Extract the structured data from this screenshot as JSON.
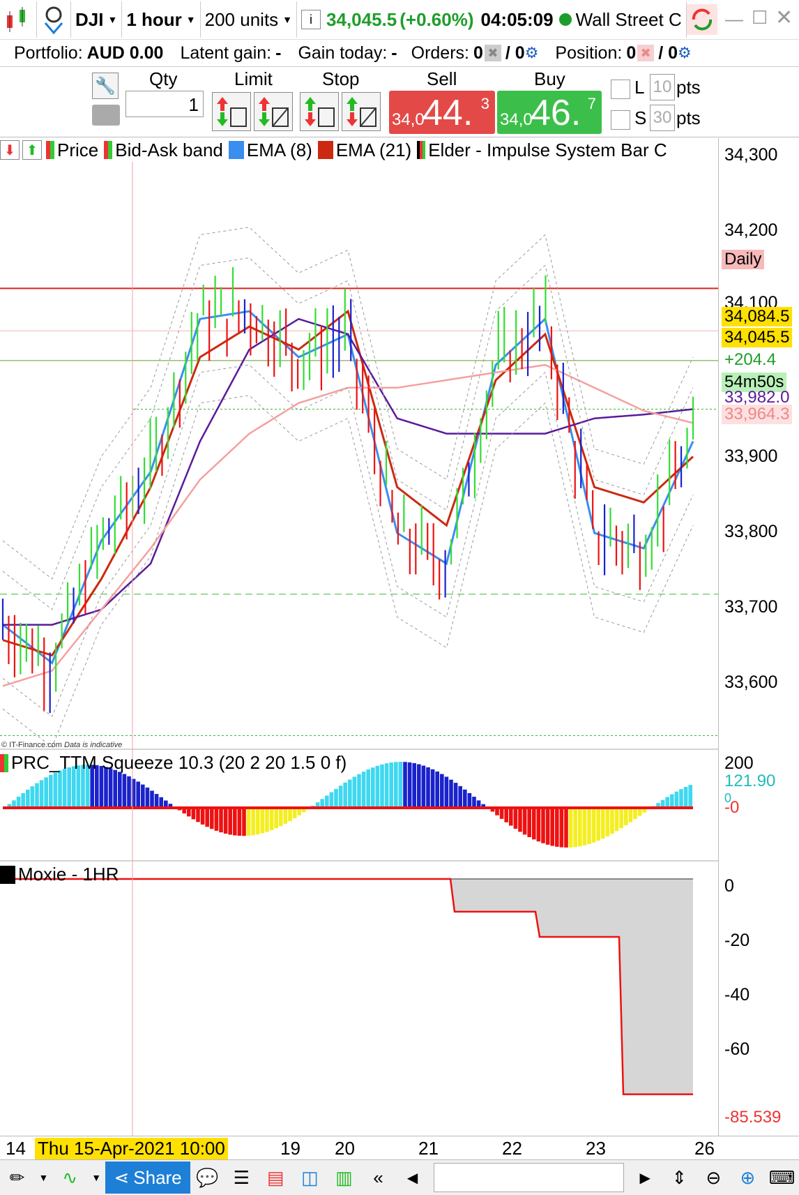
{
  "window": {
    "symbol": "DJI",
    "timeframe": "1 hour",
    "units": "200 units",
    "price": "34,045.5",
    "change": "(+0.60%)",
    "time": "04:05:09",
    "market": "Wall Street C"
  },
  "portfolio": {
    "portfolio_label": "Portfolio:",
    "portfolio_value": "AUD 0.00",
    "latent_label": "Latent gain:",
    "latent_value": "-",
    "gain_today_label": "Gain today:",
    "gain_today_value": "-",
    "orders_label": "Orders:",
    "orders_value": "0",
    "orders_value2": "/ 0",
    "position_label": "Position:",
    "position_value": "0",
    "position_value2": "/ 0"
  },
  "order": {
    "qty_label": "Qty",
    "qty_value": "1",
    "limit_label": "Limit",
    "stop_label": "Stop",
    "sell_label": "Sell",
    "buy_label": "Buy",
    "sell_small": "34,0",
    "sell_big": "44.",
    "sell_sup": "3",
    "buy_small": "34,0",
    "buy_big": "46.",
    "buy_sup": "7",
    "l_label": "L",
    "l_value": "10",
    "l_unit": "pts",
    "s_label": "S",
    "s_value": "30",
    "s_unit": "pts"
  },
  "legend": {
    "price": "Price",
    "bidask": "Bid-Ask band",
    "ema8": "EMA (8)",
    "ema21": "EMA (21)",
    "elder": "Elder - Impulse System Bar C"
  },
  "colors": {
    "up": "#33dd33",
    "down": "#ee1111",
    "neutral": "#1a22cc",
    "ema8": "#3a8ef0",
    "ema21": "#cc2a10",
    "ema_purple": "#5a1a9a",
    "ema_pink": "#f4a0a0",
    "daily_line": "#e02020"
  },
  "price_axis": {
    "ticks": [
      "34,300",
      "34,200",
      "34,100",
      "33,900",
      "33,800",
      "33,700",
      "33,600"
    ],
    "daily_tag": "Daily",
    "tag1": "34,084.5",
    "tag2": "34,045.5",
    "tag3": "+204.4",
    "tag4": "54m50s",
    "tag5": "33,982.0",
    "tag6": "33,964.3"
  },
  "watermark": "© IT-Finance.com",
  "watermark2": "Data is indicative",
  "squeeze": {
    "title": "PRC_TTM Squeeze 10.3 (20 2 20 1.5 0 f)",
    "tick_top": "200",
    "tag_value": "121.90",
    "tag_zero": "0",
    "tag_neg": "-0"
  },
  "moxie": {
    "title": "Moxie - 1HR",
    "ticks": [
      "0",
      "-20",
      "-40",
      "-60"
    ],
    "tag_value": "-85.539",
    "levels": [
      0,
      -13,
      -23,
      -85.539
    ]
  },
  "time_axis": {
    "labels": [
      "14",
      "19",
      "20",
      "21",
      "22",
      "23",
      "26"
    ],
    "cursor_label": "Thu 15-Apr-2021 10:00"
  },
  "toolbar": {
    "share": "Share"
  },
  "chart_data": {
    "type": "bar",
    "title": "",
    "ylim": [
      33550,
      34300
    ],
    "x": [
      "14",
      "19",
      "20",
      "21",
      "22",
      "23",
      "26"
    ],
    "price_tags": {
      "current": 34045.5,
      "high_line": 34084.5,
      "ema_a": 33982.0,
      "ema_b": 33964.3
    },
    "series": [
      {
        "name": "EMA (8)",
        "values": [
          33700,
          33650,
          33810,
          33900,
          34100,
          34110,
          34050,
          34080,
          33820,
          33780,
          34040,
          34100,
          33820,
          33800,
          33940
        ]
      },
      {
        "name": "EMA (21)",
        "values": [
          33680,
          33660,
          33760,
          33880,
          34050,
          34090,
          34060,
          34110,
          33880,
          33830,
          34020,
          34080,
          33880,
          33860,
          33920
        ]
      }
    ]
  }
}
